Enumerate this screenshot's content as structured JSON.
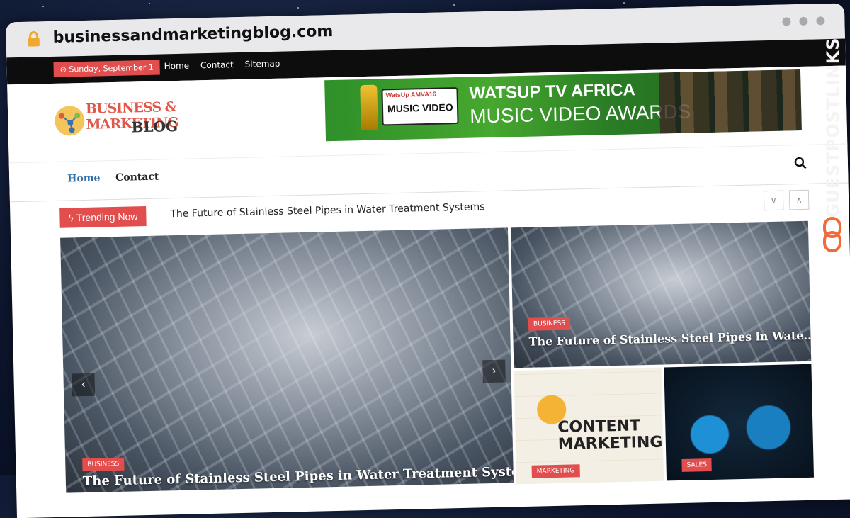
{
  "browser": {
    "url": "businessandmarketingblog.com"
  },
  "topbar": {
    "date": "Sunday, September 1",
    "links": [
      "Home",
      "Contact",
      "Sitemap"
    ]
  },
  "logo": {
    "line1": "BUSINESS & MARKETING",
    "line2": "BLOG"
  },
  "banner": {
    "badge_top": "WatsUp AMVA16",
    "badge_text": "MUSIC VIDEO",
    "title_line1": "WATSUP TV AFRICA",
    "title_line2": "MUSIC VIDEO AWARDS"
  },
  "mainnav": {
    "home": "Home",
    "contact": "Contact"
  },
  "trending": {
    "label": "Trending Now",
    "title": "The Future of Stainless Steel Pipes in Water Treatment Systems"
  },
  "featured": {
    "category": "BUSINESS",
    "title": "The Future of Stainless Steel Pipes in Water Treatment Systems"
  },
  "side_top": {
    "category": "BUSINESS",
    "title": "The Future of Stainless Steel Pipes in Wate..."
  },
  "bottom_left": {
    "category": "MARKETING",
    "image_text_1": "CONTENT",
    "image_text_2": "MARKETING"
  },
  "bottom_right": {
    "category": "SALES"
  },
  "watermark": {
    "text": "GUESTPOSTLINKS"
  },
  "colors": {
    "accent": "#e24d4d",
    "nav_active": "#2f6fa5",
    "topbar": "#0d0d0d"
  }
}
